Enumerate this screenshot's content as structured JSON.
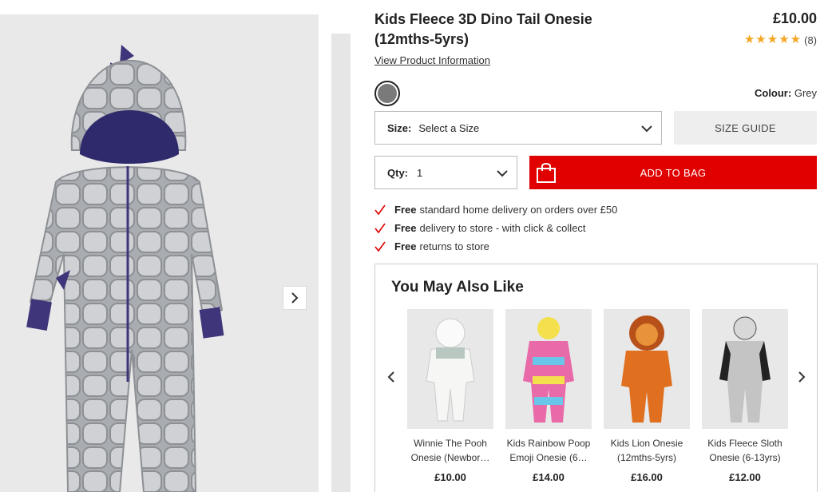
{
  "product": {
    "title": "Kids Fleece 3D Dino Tail Onesie (12mths-5yrs)",
    "price": "£10.00",
    "rating_stars": 5,
    "rating_count": "(8)",
    "view_info_link": "View Product Information",
    "colour_label": "Colour:",
    "colour_value": "Grey",
    "swatch_color": "#7a7a7a"
  },
  "size": {
    "label": "Size:",
    "value": "Select a Size",
    "guide_label": "SIZE GUIDE"
  },
  "qty": {
    "label": "Qty:",
    "value": "1"
  },
  "add_to_bag": {
    "label": "ADD TO BAG",
    "color": "#e00000"
  },
  "benefits": [
    {
      "bold": "Free",
      "text": "standard home delivery on orders over £50"
    },
    {
      "bold": "Free",
      "text": "delivery to store - with click & collect"
    },
    {
      "bold": "Free",
      "text": "returns to store"
    }
  ],
  "recommendations": {
    "title": "You May Also Like",
    "items": [
      {
        "name": "Winnie The Pooh Onesie (Newbor…",
        "price": "£10.00"
      },
      {
        "name": "Kids Rainbow Poop Emoji Onesie (6…",
        "price": "£14.00"
      },
      {
        "name": "Kids Lion Onesie (12mths-5yrs)",
        "price": "£16.00"
      },
      {
        "name": "Kids Fleece Sloth Onesie (6-13yrs)",
        "price": "£12.00"
      }
    ]
  },
  "icons": {
    "gallery_next": "chevron-right-icon",
    "select_chevron": "chevron-down-icon",
    "bag": "shopping-bag-icon",
    "tick": "tick-icon",
    "rec_prev": "chevron-left-icon",
    "rec_next": "chevron-right-icon",
    "star": "star-icon"
  }
}
